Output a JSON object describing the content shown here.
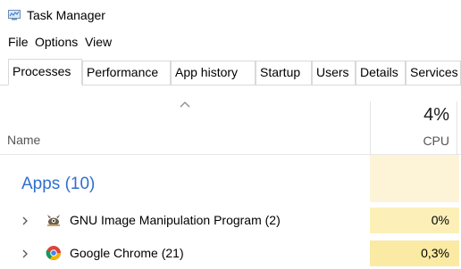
{
  "window": {
    "title": "Task Manager",
    "icon": "task-manager-icon"
  },
  "menu": {
    "items": [
      "File",
      "Options",
      "View"
    ]
  },
  "tabs": [
    {
      "label": "Processes",
      "active": true
    },
    {
      "label": "Performance"
    },
    {
      "label": "App history"
    },
    {
      "label": "Startup"
    },
    {
      "label": "Users"
    },
    {
      "label": "Details"
    },
    {
      "label": "Services"
    }
  ],
  "columns": {
    "name": {
      "label": "Name",
      "sort": "ascending"
    },
    "cpu": {
      "label": "CPU",
      "total": "4%"
    }
  },
  "groups": [
    {
      "label": "Apps (10)",
      "rows": [
        {
          "name": "GNU Image Manipulation Program (2)",
          "cpu": "0%",
          "icon": "gimp-icon"
        },
        {
          "name": "Google Chrome (21)",
          "cpu": "0,3%",
          "icon": "chrome-icon"
        }
      ]
    }
  ],
  "colors": {
    "group_text": "#2f6fd0",
    "cpu_heat_low": "#fdf4d8",
    "cpu_heat_mid": "#fcf0b8",
    "cpu_heat_high": "#faeaa3"
  }
}
